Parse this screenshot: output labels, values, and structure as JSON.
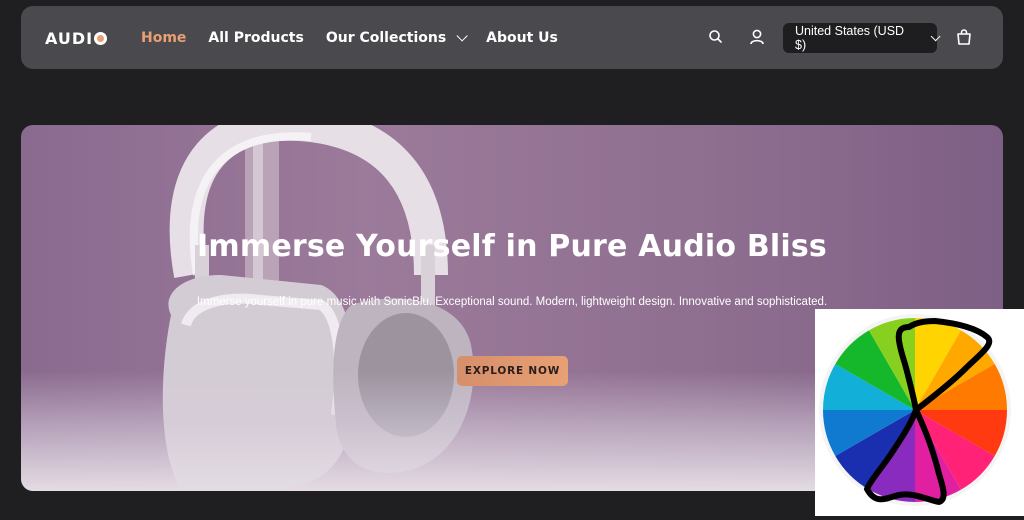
{
  "header": {
    "logo_text": "AUDI",
    "nav": [
      {
        "label": "Home",
        "active": true
      },
      {
        "label": "All Products"
      },
      {
        "label": "Our Collections",
        "has_dropdown": true
      },
      {
        "label": "About Us"
      }
    ],
    "icons": [
      "search-icon",
      "account-icon",
      "cart-icon"
    ],
    "currency_label": "United States (USD $)"
  },
  "hero": {
    "title": "Immerse Yourself in Pure Audio Bliss",
    "subtitle": "Immerse yourself in pure music with SonicBlu. Exceptional sound. Modern, lightweight design. Innovative and sophisticated.",
    "cta_label": "EXPLORE NOW"
  },
  "colors": {
    "accent": "#e8a074",
    "header_bg": "#4a494d",
    "page_bg": "#1f1e21",
    "hero_bg": "#8f6f90"
  },
  "overlay": {
    "icon": "color-wheel-icon",
    "segments": [
      "#ffd400",
      "#ffa800",
      "#ff7a00",
      "#ff3a10",
      "#ff2277",
      "#e020a0",
      "#8a2bbf",
      "#1a2fb0",
      "#0f7ad0",
      "#12b0d8",
      "#14b82a",
      "#88d020"
    ]
  }
}
